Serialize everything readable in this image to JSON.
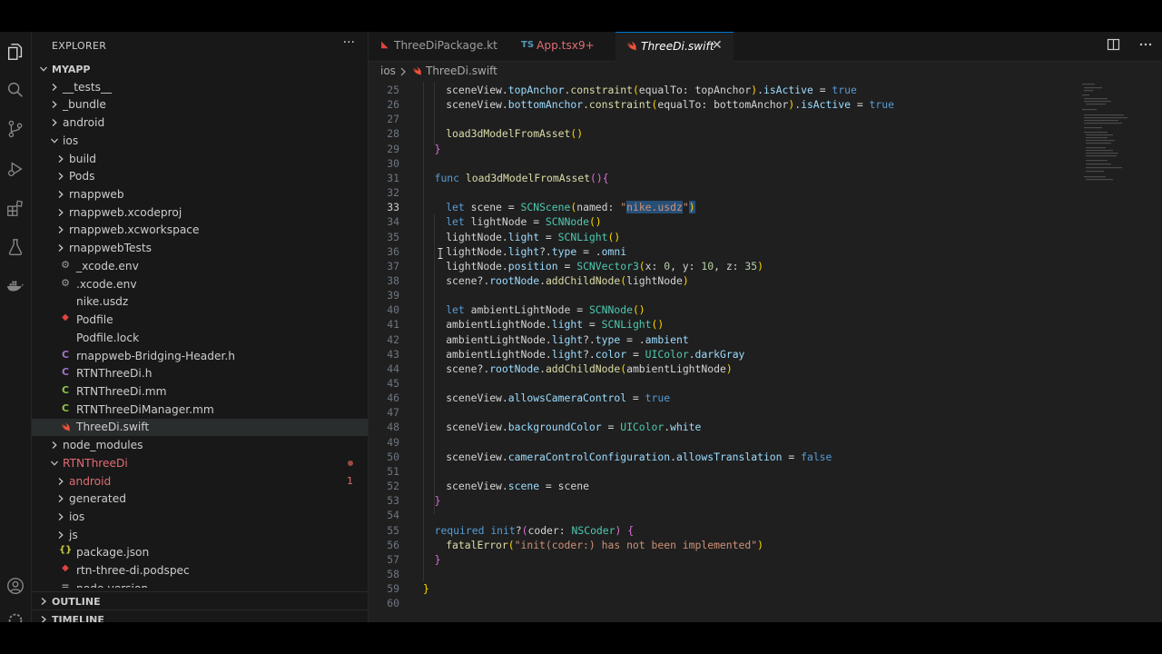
{
  "sidebar": {
    "title": "EXPLORER",
    "more": "···",
    "tree": [
      {
        "label": "MYAPP",
        "depth": 0,
        "kind": "root",
        "chev": "down"
      },
      {
        "label": "__tests__",
        "depth": 1,
        "kind": "folder",
        "chev": "right"
      },
      {
        "label": "_bundle",
        "depth": 1,
        "kind": "folder",
        "chev": "right"
      },
      {
        "label": "android",
        "depth": 1,
        "kind": "folder",
        "chev": "right"
      },
      {
        "label": "ios",
        "depth": 1,
        "kind": "folder",
        "chev": "down"
      },
      {
        "label": "build",
        "depth": 2,
        "kind": "folder",
        "chev": "right"
      },
      {
        "label": "Pods",
        "depth": 2,
        "kind": "folder",
        "chev": "right"
      },
      {
        "label": "rnappweb",
        "depth": 2,
        "kind": "folder",
        "chev": "right"
      },
      {
        "label": "rnappweb.xcodeproj",
        "depth": 2,
        "kind": "folder",
        "chev": "right"
      },
      {
        "label": "rnappweb.xcworkspace",
        "depth": 2,
        "kind": "folder",
        "chev": "right"
      },
      {
        "label": "rnappwebTests",
        "depth": 2,
        "kind": "folder",
        "chev": "right"
      },
      {
        "label": "_xcode.env",
        "depth": 2,
        "kind": "file",
        "icon": "gear",
        "icolor": "#9d9d9d"
      },
      {
        "label": ".xcode.env",
        "depth": 2,
        "kind": "file",
        "icon": "gear",
        "icolor": "#9d9d9d"
      },
      {
        "label": "nike.usdz",
        "depth": 2,
        "kind": "file",
        "icon": "none"
      },
      {
        "label": "Podfile",
        "depth": 2,
        "kind": "file",
        "icon": "ruby",
        "icolor": "#e0443e"
      },
      {
        "label": "Podfile.lock",
        "depth": 2,
        "kind": "file",
        "icon": "none"
      },
      {
        "label": "rnappweb-Bridging-Header.h",
        "depth": 2,
        "kind": "file",
        "icon": "C",
        "icolor": "#a074c4"
      },
      {
        "label": "RTNThreeDi.h",
        "depth": 2,
        "kind": "file",
        "icon": "C",
        "icolor": "#a074c4"
      },
      {
        "label": "RTNThreeDi.mm",
        "depth": 2,
        "kind": "file",
        "icon": "C",
        "icolor": "#8dc149"
      },
      {
        "label": "RTNThreeDiManager.mm",
        "depth": 2,
        "kind": "file",
        "icon": "C",
        "icolor": "#8dc149"
      },
      {
        "label": "ThreeDi.swift",
        "depth": 2,
        "kind": "file",
        "icon": "swift",
        "icolor": "#f05138",
        "selected": true
      },
      {
        "label": "node_modules",
        "depth": 1,
        "kind": "folder",
        "chev": "right"
      },
      {
        "label": "RTNThreeDi",
        "depth": 1,
        "kind": "folder",
        "chev": "down",
        "red": true,
        "dot": true
      },
      {
        "label": "android",
        "depth": 2,
        "kind": "folder",
        "chev": "right",
        "red": true,
        "badge": "1"
      },
      {
        "label": "generated",
        "depth": 2,
        "kind": "folder",
        "chev": "right"
      },
      {
        "label": "ios",
        "depth": 2,
        "kind": "folder",
        "chev": "right"
      },
      {
        "label": "js",
        "depth": 2,
        "kind": "folder",
        "chev": "right"
      },
      {
        "label": "package.json",
        "depth": 2,
        "kind": "file",
        "icon": "{}",
        "icolor": "#cbcb41"
      },
      {
        "label": "rtn-three-di.podspec",
        "depth": 2,
        "kind": "file",
        "icon": "ruby",
        "icolor": "#e0443e"
      },
      {
        "label": "node-version",
        "depth": 2,
        "kind": "file",
        "icon": "lines",
        "icolor": "#9d9d9d"
      }
    ],
    "outline": "OUTLINE",
    "timeline": "TIMELINE"
  },
  "tabs": [
    {
      "label": "ThreeDiPackage.kt",
      "icon": "kotlin",
      "active": false
    },
    {
      "label": "App.tsx",
      "icon": "TS",
      "modified": "9+",
      "active": false
    },
    {
      "label": "ThreeDi.swift",
      "icon": "swift",
      "active": true,
      "close": "✕"
    }
  ],
  "breadcrumb": {
    "folder": "ios",
    "file": "ThreeDi.swift"
  },
  "editor": {
    "current_line": 33,
    "lines": [
      {
        "n": "25",
        "indent": 1,
        "tokens": [
          [
            "pu",
            "sceneView."
          ],
          [
            "pr",
            "topAnchor"
          ],
          [
            "pu",
            "."
          ],
          [
            "fn",
            "constraint"
          ],
          [
            "br2",
            "("
          ],
          [
            "pu",
            "equalTo: topAnchor"
          ],
          [
            "br2",
            ")"
          ],
          [
            "pu",
            "."
          ],
          [
            "pr",
            "isActive"
          ],
          [
            "pu",
            " = "
          ],
          [
            "kw",
            "true"
          ]
        ]
      },
      {
        "n": "26",
        "indent": 1,
        "tokens": [
          [
            "pu",
            "sceneView."
          ],
          [
            "pr",
            "bottomAnchor"
          ],
          [
            "pu",
            "."
          ],
          [
            "fn",
            "constraint"
          ],
          [
            "br2",
            "("
          ],
          [
            "pu",
            "equalTo: bottomAnchor"
          ],
          [
            "br2",
            ")"
          ],
          [
            "pu",
            "."
          ],
          [
            "pr",
            "isActive"
          ],
          [
            "pu",
            " = "
          ],
          [
            "kw",
            "true"
          ]
        ]
      },
      {
        "n": "27",
        "indent": 0,
        "tokens": []
      },
      {
        "n": "28",
        "indent": 1,
        "tokens": [
          [
            "fn",
            "load3dModelFromAsset"
          ],
          [
            "br2",
            "()"
          ]
        ]
      },
      {
        "n": "29",
        "indent": 0,
        "tokens": [
          [
            "br1",
            "}"
          ]
        ]
      },
      {
        "n": "30",
        "indent": 0,
        "tokens": []
      },
      {
        "n": "31",
        "indent": 0,
        "tokens": [
          [
            "kw",
            "func "
          ],
          [
            "fn",
            "load3dModelFromAsset"
          ],
          [
            "br1",
            "()"
          ],
          [
            "br1",
            "{"
          ]
        ]
      },
      {
        "n": "32",
        "indent": 0,
        "tokens": []
      },
      {
        "n": "33",
        "indent": 1,
        "tokens": [
          [
            "kw",
            "let "
          ],
          [
            "pu",
            "scene = "
          ],
          [
            "ty",
            "SCNScene"
          ],
          [
            "br2",
            "("
          ],
          [
            "pu",
            "named: "
          ],
          [
            "st",
            "\""
          ],
          [
            "hlst",
            "nike.usdz"
          ],
          [
            "st",
            "\""
          ],
          [
            "hlbr",
            ")"
          ]
        ]
      },
      {
        "n": "34",
        "indent": 1,
        "tokens": [
          [
            "kw",
            "let "
          ],
          [
            "pu",
            "lightNode = "
          ],
          [
            "ty",
            "SCNNode"
          ],
          [
            "br2",
            "()"
          ]
        ]
      },
      {
        "n": "35",
        "indent": 1,
        "tokens": [
          [
            "pu",
            "lightNode."
          ],
          [
            "pr",
            "light"
          ],
          [
            "pu",
            " = "
          ],
          [
            "ty",
            "SCNLight"
          ],
          [
            "br2",
            "()"
          ]
        ]
      },
      {
        "n": "36",
        "indent": 1,
        "tokens": [
          [
            "pu",
            "lightNode."
          ],
          [
            "pr",
            "light"
          ],
          [
            "pu",
            "?."
          ],
          [
            "pr",
            "type"
          ],
          [
            "pu",
            " = ."
          ],
          [
            "pr",
            "omni"
          ]
        ]
      },
      {
        "n": "37",
        "indent": 1,
        "tokens": [
          [
            "pu",
            "lightNode."
          ],
          [
            "pr",
            "position"
          ],
          [
            "pu",
            " = "
          ],
          [
            "ty",
            "SCNVector3"
          ],
          [
            "br2",
            "("
          ],
          [
            "pu",
            "x: "
          ],
          [
            "nm",
            "0"
          ],
          [
            "pu",
            ", y: "
          ],
          [
            "nm",
            "10"
          ],
          [
            "pu",
            ", z: "
          ],
          [
            "nm",
            "35"
          ],
          [
            "br2",
            ")"
          ]
        ]
      },
      {
        "n": "38",
        "indent": 1,
        "tokens": [
          [
            "pu",
            "scene?."
          ],
          [
            "pr",
            "rootNode"
          ],
          [
            "pu",
            "."
          ],
          [
            "fn",
            "addChildNode"
          ],
          [
            "br2",
            "("
          ],
          [
            "pu",
            "lightNode"
          ],
          [
            "br2",
            ")"
          ]
        ]
      },
      {
        "n": "39",
        "indent": 0,
        "tokens": []
      },
      {
        "n": "40",
        "indent": 1,
        "tokens": [
          [
            "kw",
            "let "
          ],
          [
            "pu",
            "ambientLightNode = "
          ],
          [
            "ty",
            "SCNNode"
          ],
          [
            "br2",
            "()"
          ]
        ]
      },
      {
        "n": "41",
        "indent": 1,
        "tokens": [
          [
            "pu",
            "ambientLightNode."
          ],
          [
            "pr",
            "light"
          ],
          [
            "pu",
            " = "
          ],
          [
            "ty",
            "SCNLight"
          ],
          [
            "br2",
            "()"
          ]
        ]
      },
      {
        "n": "42",
        "indent": 1,
        "tokens": [
          [
            "pu",
            "ambientLightNode."
          ],
          [
            "pr",
            "light"
          ],
          [
            "pu",
            "?."
          ],
          [
            "pr",
            "type"
          ],
          [
            "pu",
            " = ."
          ],
          [
            "pr",
            "ambient"
          ]
        ]
      },
      {
        "n": "43",
        "indent": 1,
        "tokens": [
          [
            "pu",
            "ambientLightNode."
          ],
          [
            "pr",
            "light"
          ],
          [
            "pu",
            "?."
          ],
          [
            "pr",
            "color"
          ],
          [
            "pu",
            " = "
          ],
          [
            "ty",
            "UIColor"
          ],
          [
            "pu",
            "."
          ],
          [
            "pr",
            "darkGray"
          ]
        ]
      },
      {
        "n": "44",
        "indent": 1,
        "tokens": [
          [
            "pu",
            "scene?."
          ],
          [
            "pr",
            "rootNode"
          ],
          [
            "pu",
            "."
          ],
          [
            "fn",
            "addChildNode"
          ],
          [
            "br2",
            "("
          ],
          [
            "pu",
            "ambientLightNode"
          ],
          [
            "br2",
            ")"
          ]
        ]
      },
      {
        "n": "45",
        "indent": 0,
        "tokens": []
      },
      {
        "n": "46",
        "indent": 1,
        "tokens": [
          [
            "pu",
            "sceneView."
          ],
          [
            "pr",
            "allowsCameraControl"
          ],
          [
            "pu",
            " = "
          ],
          [
            "kw",
            "true"
          ]
        ]
      },
      {
        "n": "47",
        "indent": 0,
        "tokens": []
      },
      {
        "n": "48",
        "indent": 1,
        "tokens": [
          [
            "pu",
            "sceneView."
          ],
          [
            "pr",
            "backgroundColor"
          ],
          [
            "pu",
            " = "
          ],
          [
            "ty",
            "UIColor"
          ],
          [
            "pu",
            "."
          ],
          [
            "pr",
            "white"
          ]
        ]
      },
      {
        "n": "49",
        "indent": 0,
        "tokens": []
      },
      {
        "n": "50",
        "indent": 1,
        "tokens": [
          [
            "pu",
            "sceneView."
          ],
          [
            "pr",
            "cameraControlConfiguration"
          ],
          [
            "pu",
            "."
          ],
          [
            "pr",
            "allowsTranslation"
          ],
          [
            "pu",
            " = "
          ],
          [
            "kw",
            "false"
          ]
        ]
      },
      {
        "n": "51",
        "indent": 0,
        "tokens": []
      },
      {
        "n": "52",
        "indent": 1,
        "tokens": [
          [
            "pu",
            "sceneView."
          ],
          [
            "pr",
            "scene"
          ],
          [
            "pu",
            " = scene"
          ]
        ]
      },
      {
        "n": "53",
        "indent": 0,
        "tokens": [
          [
            "br1",
            "}"
          ]
        ]
      },
      {
        "n": "54",
        "indent": 0,
        "tokens": []
      },
      {
        "n": "55",
        "indent": 0,
        "tokens": [
          [
            "kw",
            "required "
          ],
          [
            "kw",
            "init"
          ],
          [
            "pu",
            "?"
          ],
          [
            "br1",
            "("
          ],
          [
            "pu",
            "coder: "
          ],
          [
            "ty",
            "NSCoder"
          ],
          [
            "br1",
            ")"
          ],
          [
            "pu",
            " "
          ],
          [
            "br1",
            "{"
          ]
        ]
      },
      {
        "n": "56",
        "indent": 1,
        "tokens": [
          [
            "fn",
            "fatalError"
          ],
          [
            "br2",
            "("
          ],
          [
            "st",
            "\"init(coder:) has not been implemented\""
          ],
          [
            "br2",
            ")"
          ]
        ]
      },
      {
        "n": "57",
        "indent": 0,
        "tokens": [
          [
            "br1",
            "}"
          ]
        ]
      },
      {
        "n": "58",
        "indent": 0,
        "tokens": []
      },
      {
        "n": "59",
        "indent": -1,
        "tokens": [
          [
            "br2",
            "}"
          ]
        ]
      },
      {
        "n": "60",
        "indent": -1,
        "tokens": []
      }
    ]
  },
  "colors": {
    "accent": "#0078d4",
    "error": "#e06c75",
    "swift": "#f05138"
  }
}
